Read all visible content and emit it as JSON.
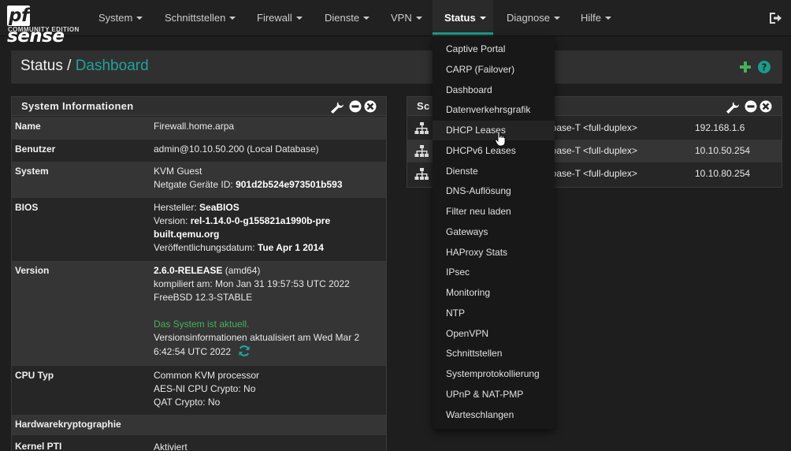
{
  "brand": {
    "logo_text": "sense",
    "logo_pf": "pf",
    "edition": "COMMUNITY EDITION"
  },
  "nav": {
    "items": [
      {
        "label": "System"
      },
      {
        "label": "Schnittstellen"
      },
      {
        "label": "Firewall"
      },
      {
        "label": "Dienste"
      },
      {
        "label": "VPN"
      },
      {
        "label": "Status",
        "active": true
      },
      {
        "label": "Diagnose"
      },
      {
        "label": "Hilfe"
      }
    ],
    "logout_icon": "sign-out-icon"
  },
  "page": {
    "breadcrumb_root": "Status /",
    "breadcrumb_link": "Dashboard"
  },
  "accent_color": "#1a9c8c",
  "system_info": {
    "title": "System Informationen",
    "rows": {
      "name": {
        "k": "Name",
        "v": "Firewall.home.arpa"
      },
      "user": {
        "k": "Benutzer",
        "v": "admin@10.10.50.200 (Local Database)"
      },
      "system": {
        "k": "System",
        "v1": "KVM Guest",
        "v2_label": "Netgate Geräte ID: ",
        "v2_value": "901d2b524e973501b593"
      },
      "bios": {
        "k": "BIOS",
        "vendor_label": "Hersteller: ",
        "vendor": "SeaBIOS",
        "version_label": "Version: ",
        "version": "rel-1.14.0-0-g155821a1990b-prebuilt.qemu.org",
        "date_label": "Veröffentlichungsdatum: ",
        "date": "Tue Apr 1 2014"
      },
      "version": {
        "k": "Version",
        "release": "2.6.0-RELEASE",
        "arch": " (amd64)",
        "compiled": "kompiliert am: Mon Jan 31 19:57:53 UTC 2022",
        "freebsd": "FreeBSD 12.3-STABLE",
        "uptodate": "Das System ist aktuell.",
        "info": "Versionsinformationen aktualisiert am Wed Mar 2 6:42:54 UTC 2022"
      },
      "cpu": {
        "k": "CPU Typ",
        "v1": "Common KVM processor",
        "v2": "AES-NI CPU Crypto: No",
        "v3": "QAT Crypto: No"
      },
      "hwcrypto": {
        "k": "Hardwarekryptographie"
      },
      "pti": {
        "k": "Kernel PTI",
        "v": "Aktiviert"
      }
    }
  },
  "interfaces": {
    "title_visible": "Sc",
    "rows": [
      {
        "media": "10Gbase-T <full-duplex>",
        "ip": "192.168.1.6"
      },
      {
        "media": "10Gbase-T <full-duplex>",
        "ip": "10.10.50.254"
      },
      {
        "media": "10Gbase-T <full-duplex>",
        "ip": "10.10.80.254"
      }
    ]
  },
  "status_menu": {
    "items": [
      "Captive Portal",
      "CARP (Failover)",
      "Dashboard",
      "Datenverkehrsgrafik",
      "DHCP Leases",
      "DHCPv6 Leases",
      "Dienste",
      "DNS-Auflösung",
      "Filter neu laden",
      "Gateways",
      "HAProxy Stats",
      "IPsec",
      "Monitoring",
      "NTP",
      "OpenVPN",
      "Schnittstellen",
      "Systemprotokollierung",
      "UPnP & NAT-PMP",
      "Warteschlangen"
    ],
    "hovered": "DHCP Leases"
  }
}
